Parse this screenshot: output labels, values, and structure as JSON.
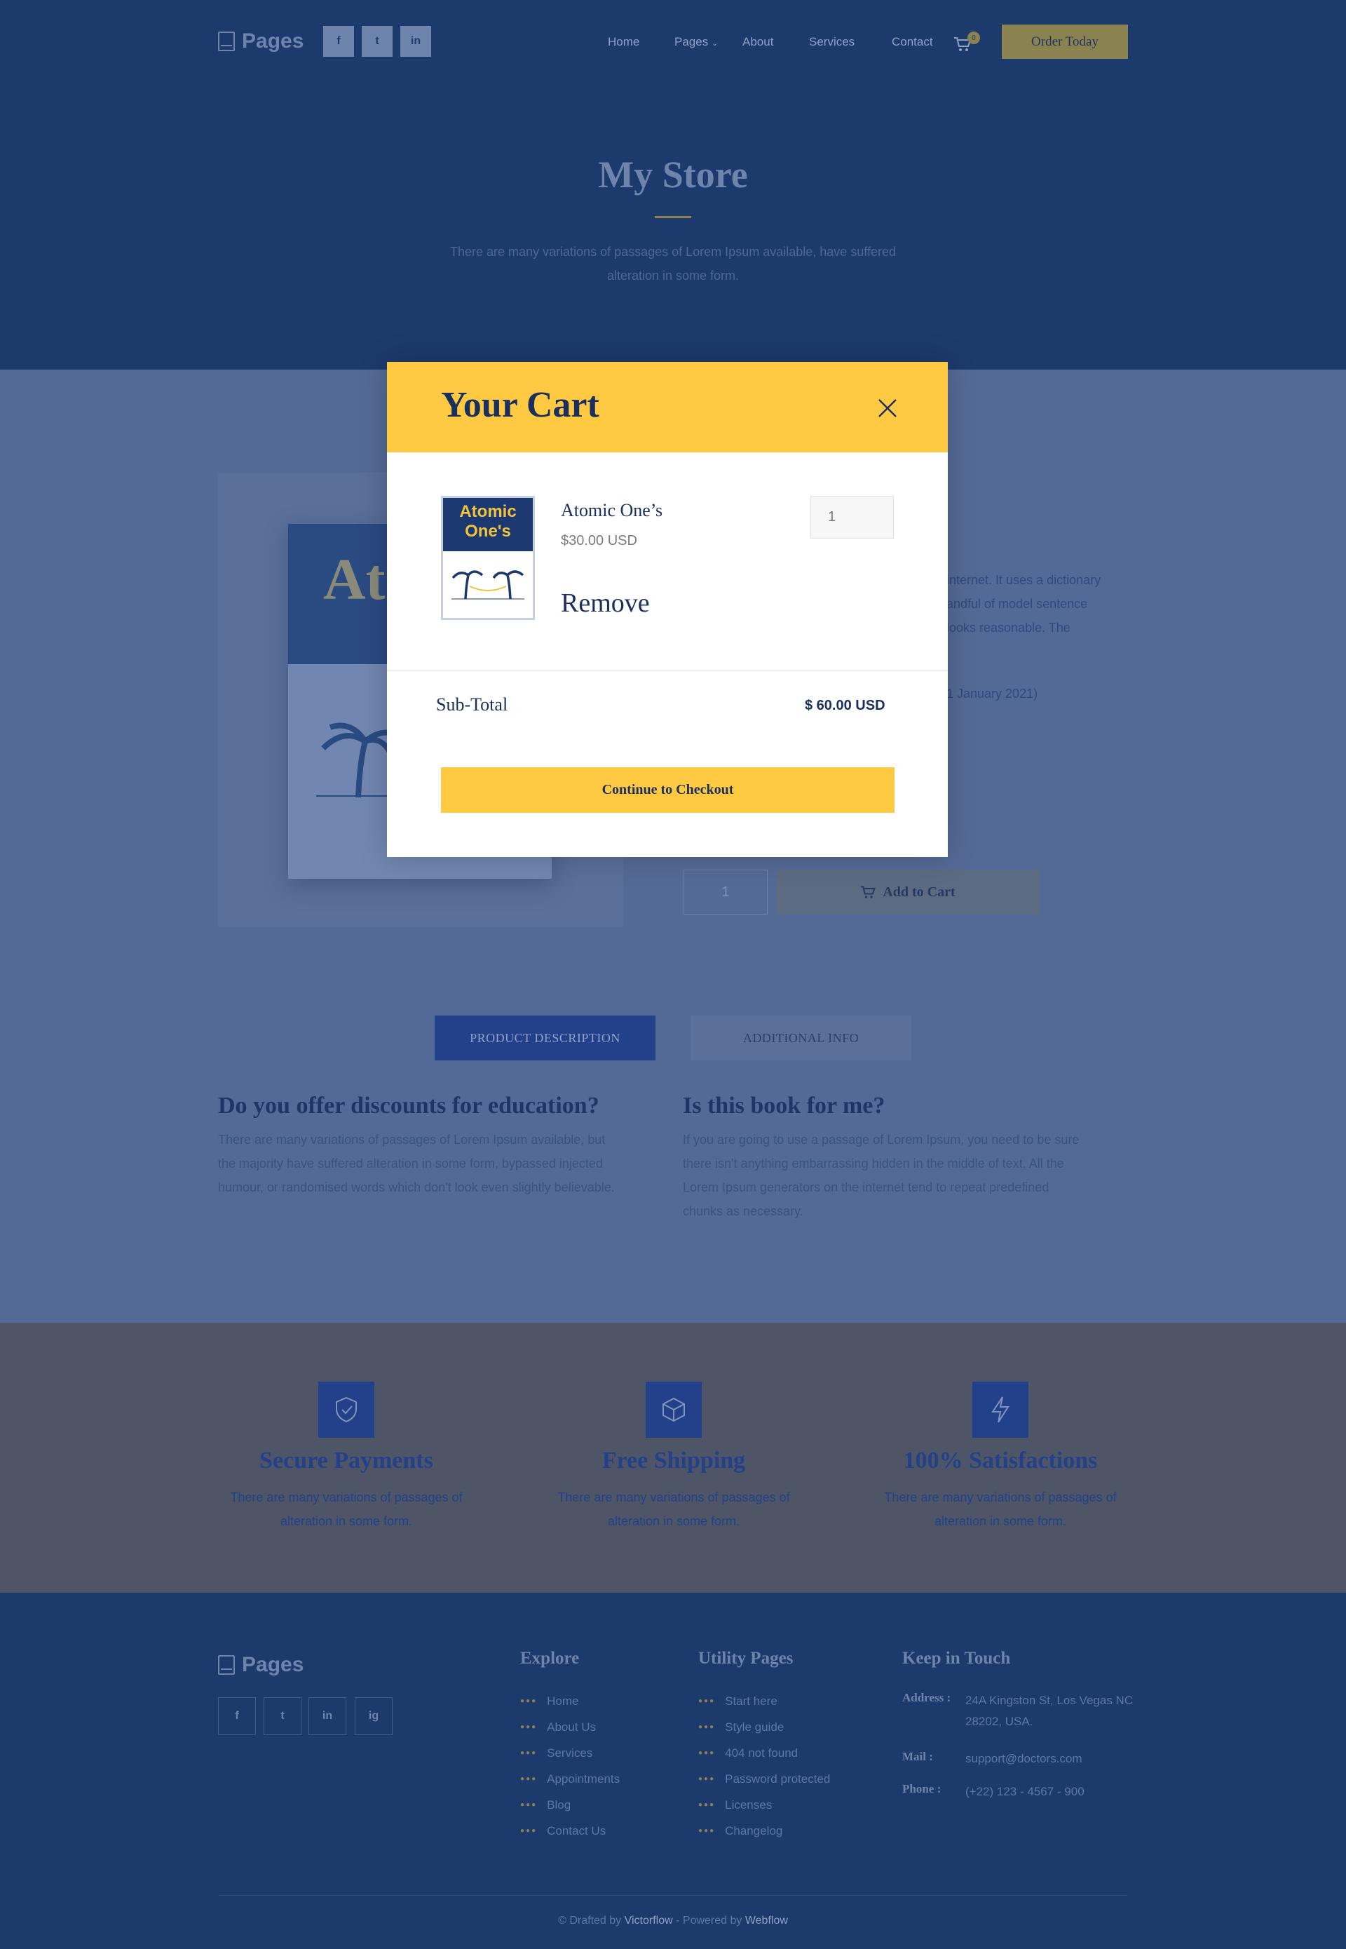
{
  "header": {
    "logo_text": "Pages",
    "social": [
      "f",
      "t",
      "in"
    ],
    "nav": [
      "Home",
      "Pages",
      "About",
      "Services",
      "Contact"
    ],
    "cart_count": "0",
    "order_button": "Order Today"
  },
  "hero": {
    "title": "My Store",
    "text": "There are many variations of passages of Lorem Ipsum available,  have suffered alteration in some form."
  },
  "product_bg": {
    "book_title_fragment": "At O",
    "desc_line1": "internet. It uses a dictionary",
    "desc_line2": "andful of model sentence",
    "desc_line3": "looks reasonable. The",
    "date_fragment": "1 January 2021)",
    "qty_value": "1",
    "add_to_cart": "Add to Cart"
  },
  "tabs": {
    "description": "PRODUCT DESCRIPTION",
    "additional": "ADDITIONAL INFO"
  },
  "faq": [
    {
      "title": "Do you offer discounts for education?",
      "text": "There are many variations of passages of Lorem Ipsum available, but the majority have suffered alteration in some form, bypassed injected humour, or randomised words which don't look even slightly believable."
    },
    {
      "title": "Is this book for me?",
      "text": "If you are going to use a passage of Lorem Ipsum, you need to be sure there isn't anything embarrassing hidden in the middle of text. All the Lorem Ipsum generators on the internet tend to repeat predefined chunks as necessary."
    }
  ],
  "features": [
    {
      "icon": "shield-check-icon",
      "title": "Secure Payments",
      "text": "There are many variations of passages of alteration in some form."
    },
    {
      "icon": "box-icon",
      "title": "Free Shipping",
      "text": "There are many variations of passages of alteration in some form."
    },
    {
      "icon": "lightning-icon",
      "title": "100% Satisfactions",
      "text": "There are many variations of passages of alteration in some form."
    }
  ],
  "footer": {
    "logo_text": "Pages",
    "social": [
      "f",
      "t",
      "in",
      "ig"
    ],
    "explore": {
      "title": "Explore",
      "items": [
        "Home",
        "About Us",
        "Services",
        "Appointments",
        "Blog",
        "Contact Us"
      ]
    },
    "utility": {
      "title": "Utility Pages",
      "items": [
        "Start here",
        "Style guide",
        "404 not found",
        "Password protected",
        "Licenses",
        "Changelog"
      ]
    },
    "contact": {
      "title": "Keep in Touch",
      "address_label": "Address :",
      "address": "24A Kingston St, Los Vegas NC 28202, USA.",
      "mail_label": "Mail :",
      "mail": "support@doctors.com",
      "phone_label": "Phone :",
      "phone": "(+22) 123 - 4567 - 900"
    },
    "credits": {
      "prefix": "© Drafted by ",
      "author": "Victorflow",
      "middle": " - Powered by ",
      "platform": "Webflow"
    }
  },
  "cart_modal": {
    "title": "Your Cart",
    "item": {
      "thumb_line1": "Atomic",
      "thumb_line2": "One's",
      "name": "Atomic One’s",
      "price": "$30.00 USD",
      "quantity": "1",
      "remove_label": "Remove"
    },
    "subtotal_label": "Sub-Total",
    "subtotal_value": "$ 60.00 USD",
    "checkout_label": "Continue to Checkout"
  },
  "colors": {
    "accent_yellow": "#ffc942",
    "navy": "#1d3a6d",
    "overlay_blue": "#546a96"
  }
}
